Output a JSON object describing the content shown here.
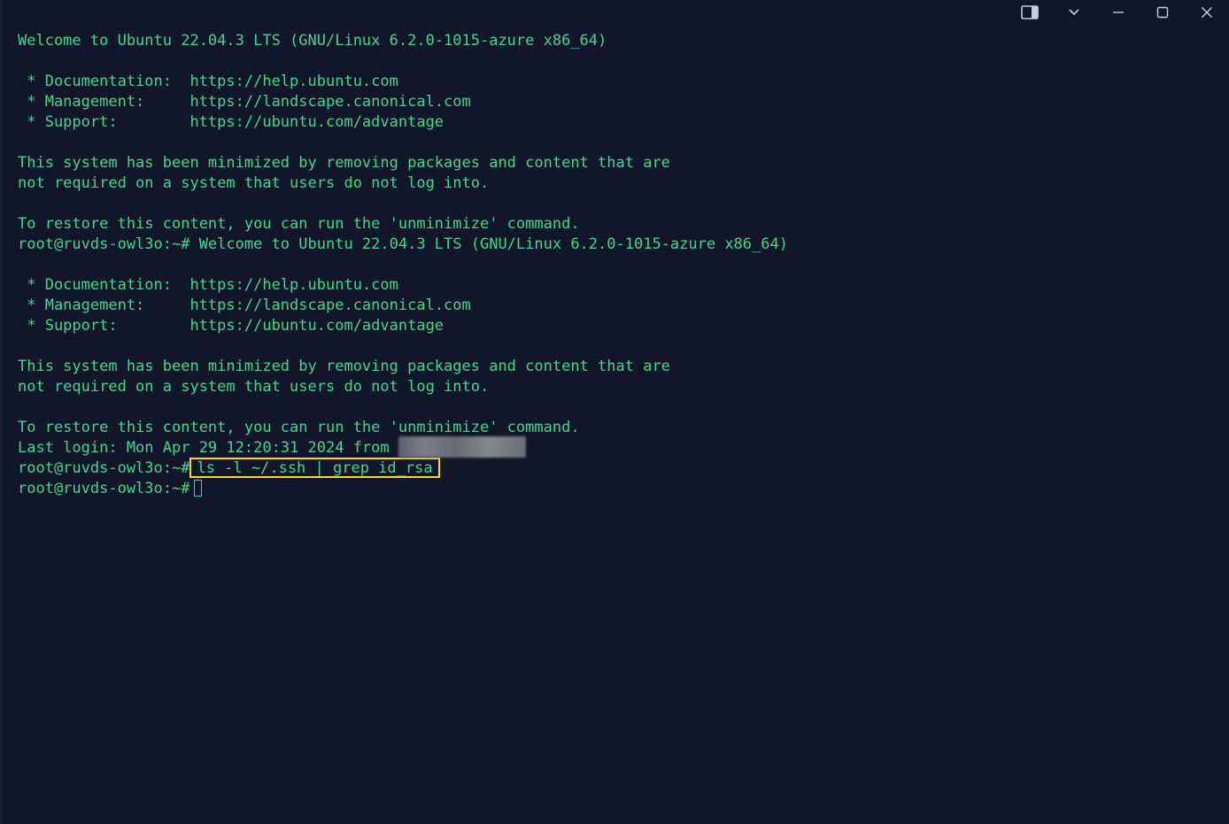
{
  "window": {
    "controls": [
      {
        "name": "panel-toggle-icon"
      },
      {
        "name": "chevron-down-icon"
      },
      {
        "name": "minimize-icon"
      },
      {
        "name": "maximize-icon"
      },
      {
        "name": "close-icon"
      }
    ]
  },
  "terminal": {
    "lines": [
      "Welcome to Ubuntu 22.04.3 LTS (GNU/Linux 6.2.0-1015-azure x86_64)",
      "",
      " * Documentation:  https://help.ubuntu.com",
      " * Management:     https://landscape.canonical.com",
      " * Support:        https://ubuntu.com/advantage",
      "",
      "This system has been minimized by removing packages and content that are",
      "not required on a system that users do not log into.",
      "",
      "To restore this content, you can run the 'unminimize' command.",
      "root@ruvds-owl3o:~# Welcome to Ubuntu 22.04.3 LTS (GNU/Linux 6.2.0-1015-azure x86_64)",
      "",
      " * Documentation:  https://help.ubuntu.com",
      " * Management:     https://landscape.canonical.com",
      " * Support:        https://ubuntu.com/advantage",
      "",
      "This system has been minimized by removing packages and content that are",
      "not required on a system that users do not log into.",
      "",
      "To restore this content, you can run the 'unminimize' command."
    ],
    "last_login": "Last login: Mon Apr 29 12:20:31 2024 from ",
    "prompt": "root@ruvds-owl3o:~#",
    "highlighted_command": "ls -l ~/.ssh | grep id_rsa",
    "highlight_color": "#f5dc1c",
    "text_color": "#3fd88d",
    "background_color": "#12162a"
  }
}
